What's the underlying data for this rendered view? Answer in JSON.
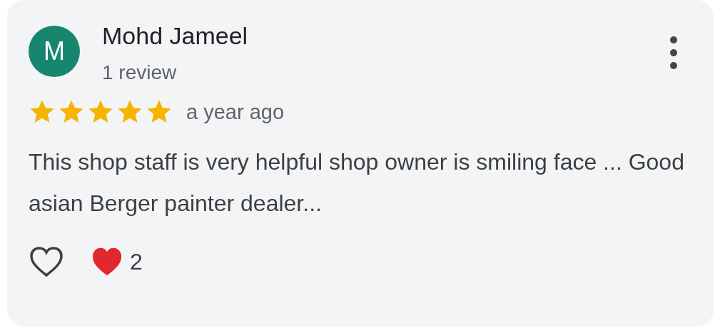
{
  "review": {
    "avatar_letter": "M",
    "author": "Mohd Jameel",
    "author_meta": "1 review",
    "stars": 5,
    "time": "a year ago",
    "text": "This shop staff is very helpful shop owner is smiling face ... Good asian Berger painter dealer...",
    "reaction_count": "2"
  }
}
